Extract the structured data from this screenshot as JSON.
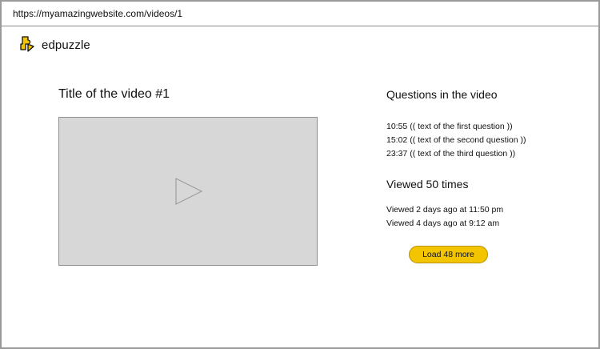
{
  "browser": {
    "url": "https://myamazingwebsite.com/videos/1"
  },
  "brand": {
    "name": "edpuzzle",
    "logo_icon": "puzzle-piece-icon",
    "logo_color": "#f2c500"
  },
  "video": {
    "title": "Title of the video #1",
    "play_icon": "play-icon"
  },
  "questions": {
    "heading": "Questions in the video",
    "items": [
      "10:55 (( text of the first question ))",
      "15:02 (( text of the second question ))",
      "23:37 (( text of the third question ))"
    ]
  },
  "views": {
    "heading": "Viewed 50 times",
    "items": [
      "Viewed 2 days ago at 11:50 pm",
      "Viewed 4 days ago at 9:12 am"
    ],
    "load_more_label": "Load 48 more"
  },
  "colors": {
    "accent": "#f2c500",
    "player_bg": "#d7d7d7"
  }
}
